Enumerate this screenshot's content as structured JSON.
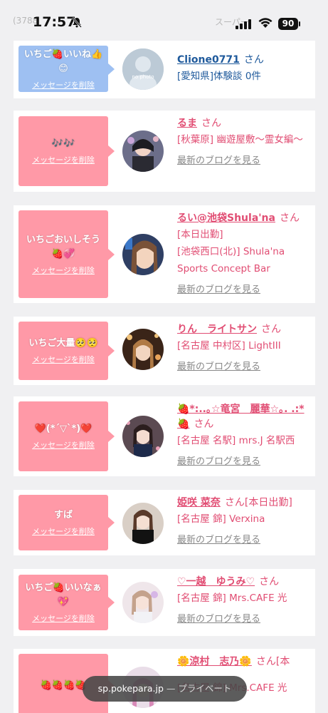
{
  "status_bar": {
    "time": "17:57",
    "battery": "90",
    "under_left": "(3788",
    "under_right": "スーパー"
  },
  "url_bar": {
    "host": "sp.pokepara.jp",
    "mode": "— プライベート"
  },
  "cards": [
    {
      "message": "いちご🍓いいね👍😊",
      "delete_label": "メッセージを削除",
      "bubble_color": "#9ec0f2",
      "name": "Clione0771",
      "san": "さん",
      "details": [
        "[愛知県]体験談 0件"
      ],
      "blog": "",
      "avatar": "no-photo"
    },
    {
      "message": "🎶🎶",
      "delete_label": "メッセージを削除",
      "bubble_color": "#ff99a7",
      "name": "るま",
      "san": "さん",
      "details": [
        "[秋葉原] 幽遊屋敷〜霊女編〜"
      ],
      "blog": "最新のブログを見る",
      "avatar": "photo"
    },
    {
      "message": "いちごおいしそう🍓💞",
      "delete_label": "メッセージを削除",
      "bubble_color": "#ff99a7",
      "name": "るい@池袋Shula'na",
      "san": "さん",
      "details": [
        "[本日出勤]",
        "[池袋西口(北)] Shula'na Sports Concept Bar"
      ],
      "blog": "最新のブログを見る",
      "avatar": "photo"
    },
    {
      "message": "いちご大量🥺🥺",
      "delete_label": "メッセージを削除",
      "bubble_color": "#ff99a7",
      "name": "りん　ライトサン",
      "san": "さん",
      "details": [
        "[名古屋 中村区] LightIII"
      ],
      "blog": "最新のブログを見る",
      "avatar": "photo"
    },
    {
      "message": "❤️(*´▽`*)❤️",
      "delete_label": "メッセージを削除",
      "bubble_color": "#ff99a7",
      "name": "🍓*:..｡☆竜宮　麗華☆｡. .:*🍓",
      "san": "さん",
      "details": [
        "[名古屋 名駅] mrs.J 名駅西"
      ],
      "blog": "最新のブログを見る",
      "avatar": "photo"
    },
    {
      "message": "すば",
      "delete_label": "メッセージを削除",
      "bubble_color": "#ff99a7",
      "name": "姫咲 菜奈",
      "san": "さん[本日出勤]",
      "details": [
        "[名古屋 錦] Verxina"
      ],
      "blog": "最新のブログを見る",
      "avatar": "photo"
    },
    {
      "message": "いちご🍓いいなぁ💖",
      "delete_label": "メッセージを削除",
      "bubble_color": "#ff99a7",
      "name": "♡一越　ゆうみ♡",
      "san": "さん",
      "details": [
        "[名古屋 錦] Mrs.CAFE 光"
      ],
      "blog": "最新のブログを見る",
      "avatar": "photo"
    },
    {
      "message": "🍓🍓🍓🍓",
      "delete_label": "",
      "bubble_color": "#ff99a7",
      "name": "🌼涼村　志乃🌼",
      "san": "さん[本",
      "details": [
        "[名古屋 錦] Mrs.CAFE 光"
      ],
      "blog": "",
      "avatar": "photo"
    }
  ]
}
